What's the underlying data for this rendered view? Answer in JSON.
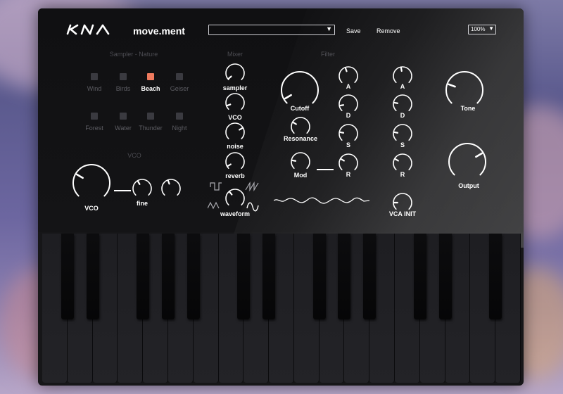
{
  "app": {
    "logo": "KIA",
    "title": "move.ment"
  },
  "toolbar": {
    "preset_value": "",
    "save_label": "Save",
    "remove_label": "Remove",
    "zoom_value": "100%"
  },
  "sampler": {
    "title": "Sampler - Nature",
    "pads": [
      {
        "label": "Wind",
        "active": false
      },
      {
        "label": "Birds",
        "active": false
      },
      {
        "label": "Beach",
        "active": true
      },
      {
        "label": "Geiser",
        "active": false
      },
      {
        "label": "Forest",
        "active": false
      },
      {
        "label": "Water",
        "active": false
      },
      {
        "label": "Thunder",
        "active": false
      },
      {
        "label": "Night",
        "active": false
      }
    ]
  },
  "vco": {
    "title": "VCO",
    "knob_label": "VCO",
    "fine_label": "fine"
  },
  "mixer": {
    "title": "Mixer",
    "sampler_label": "sampler",
    "vco_label": "VCO",
    "noise_label": "noise",
    "reverb_label": "reverb",
    "waveform_label": "waveform"
  },
  "filter": {
    "title": "Filter",
    "cutoff_label": "Cutoff",
    "resonance_label": "Resonance",
    "mod_label": "Mod",
    "a": "A",
    "d": "D",
    "s": "S",
    "r": "R"
  },
  "env": {
    "title": "",
    "a": "A",
    "d": "D",
    "s": "S",
    "r": "R",
    "vca_init_label": "VCA INIT"
  },
  "out": {
    "title": "",
    "tone_label": "Tone",
    "output_label": "Output"
  },
  "colors": {
    "accent": "#ef7a5e",
    "panel": "#131315",
    "text": "#ffffff",
    "dim": "#5d5d63"
  }
}
